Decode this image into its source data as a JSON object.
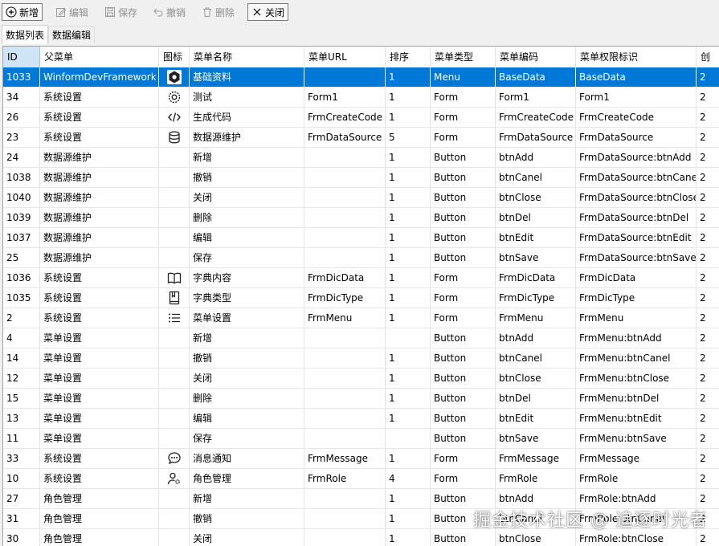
{
  "toolbar": {
    "new": "新增",
    "edit": "编辑",
    "save": "保存",
    "cancel": "撤销",
    "delete": "删除",
    "close": "关闭"
  },
  "tabs": [
    "数据列表",
    "数据编辑"
  ],
  "columns": [
    "ID",
    "父菜单",
    "图标",
    "菜单名称",
    "菜单URL",
    "排序",
    "菜单类型",
    "菜单编码",
    "菜单权限标识",
    "创"
  ],
  "colors": {
    "selection": "#0078d7",
    "header_id_bg": "#cfe4f7"
  },
  "rows": [
    {
      "id": "1033",
      "parent": "WinformDevFramework",
      "icon": "hexagon-icon",
      "name": "基础资料",
      "url": "",
      "sort": "1",
      "type": "Menu",
      "code": "BaseData",
      "perm": "BaseData",
      "extra": "2"
    },
    {
      "id": "34",
      "parent": "系统设置",
      "icon": "settings-icon",
      "name": "测试",
      "url": "Form1",
      "sort": "1",
      "type": "Form",
      "code": "Form1",
      "perm": "Form1",
      "extra": "2"
    },
    {
      "id": "26",
      "parent": "系统设置",
      "icon": "code-icon",
      "name": "生成代码",
      "url": "FrmCreateCode",
      "sort": "1",
      "type": "Form",
      "code": "FrmCreateCode",
      "perm": "FrmCreateCode",
      "extra": "2"
    },
    {
      "id": "23",
      "parent": "系统设置",
      "icon": "database-icon",
      "name": "数据源维护",
      "url": "FrmDataSource",
      "sort": "5",
      "type": "Form",
      "code": "FrmDataSource",
      "perm": "FrmDataSource",
      "extra": "2"
    },
    {
      "id": "24",
      "parent": "数据源维护",
      "icon": "",
      "name": "新增",
      "url": "",
      "sort": "1",
      "type": "Button",
      "code": "btnAdd",
      "perm": "FrmDataSource:btnAdd",
      "extra": "2"
    },
    {
      "id": "1038",
      "parent": "数据源维护",
      "icon": "",
      "name": "撤销",
      "url": "",
      "sort": "1",
      "type": "Button",
      "code": "btnCanel",
      "perm": "FrmDataSource:btnCanel",
      "extra": "2"
    },
    {
      "id": "1040",
      "parent": "数据源维护",
      "icon": "",
      "name": "关闭",
      "url": "",
      "sort": "1",
      "type": "Button",
      "code": "btnClose",
      "perm": "FrmDataSource:btnClose",
      "extra": "2"
    },
    {
      "id": "1039",
      "parent": "数据源维护",
      "icon": "",
      "name": "删除",
      "url": "",
      "sort": "1",
      "type": "Button",
      "code": "btnDel",
      "perm": "FrmDataSource:btnDel",
      "extra": "2"
    },
    {
      "id": "1037",
      "parent": "数据源维护",
      "icon": "",
      "name": "编辑",
      "url": "",
      "sort": "1",
      "type": "Button",
      "code": "btnEdit",
      "perm": "FrmDataSource:btnEdit",
      "extra": "2"
    },
    {
      "id": "25",
      "parent": "数据源维护",
      "icon": "",
      "name": "保存",
      "url": "",
      "sort": "1",
      "type": "Button",
      "code": "btnSave",
      "perm": "FrmDataSource:btnSave",
      "extra": "2"
    },
    {
      "id": "1036",
      "parent": "系统设置",
      "icon": "book-open-icon",
      "name": "字典内容",
      "url": "FrmDicData",
      "sort": "1",
      "type": "Form",
      "code": "FrmDicData",
      "perm": "FrmDicData",
      "extra": "2"
    },
    {
      "id": "1035",
      "parent": "系统设置",
      "icon": "book-icon",
      "name": "字典类型",
      "url": "FrmDicType",
      "sort": "1",
      "type": "Form",
      "code": "FrmDicType",
      "perm": "FrmDicType",
      "extra": "2"
    },
    {
      "id": "2",
      "parent": "系统设置",
      "icon": "list-icon",
      "name": "菜单设置",
      "url": "FrmMenu",
      "sort": "1",
      "type": "Form",
      "code": "FrmMenu",
      "perm": "FrmMenu",
      "extra": "2"
    },
    {
      "id": "4",
      "parent": "菜单设置",
      "icon": "",
      "name": "新增",
      "url": "",
      "sort": "",
      "type": "Button",
      "code": "btnAdd",
      "perm": "FrmMenu:btnAdd",
      "extra": "2"
    },
    {
      "id": "14",
      "parent": "菜单设置",
      "icon": "",
      "name": "撤销",
      "url": "",
      "sort": "1",
      "type": "Button",
      "code": "btnCanel",
      "perm": "FrmMenu:btnCanel",
      "extra": "2"
    },
    {
      "id": "12",
      "parent": "菜单设置",
      "icon": "",
      "name": "关闭",
      "url": "",
      "sort": "1",
      "type": "Button",
      "code": "btnClose",
      "perm": "FrmMenu:btnClose",
      "extra": "2"
    },
    {
      "id": "15",
      "parent": "菜单设置",
      "icon": "",
      "name": "删除",
      "url": "",
      "sort": "1",
      "type": "Button",
      "code": "btnDel",
      "perm": "FrmMenu:btnDel",
      "extra": "2"
    },
    {
      "id": "13",
      "parent": "菜单设置",
      "icon": "",
      "name": "编辑",
      "url": "",
      "sort": "1",
      "type": "Button",
      "code": "btnEdit",
      "perm": "FrmMenu:btnEdit",
      "extra": "2"
    },
    {
      "id": "11",
      "parent": "菜单设置",
      "icon": "",
      "name": "保存",
      "url": "",
      "sort": "",
      "type": "Button",
      "code": "btnSave",
      "perm": "FrmMenu:btnSave",
      "extra": "2"
    },
    {
      "id": "33",
      "parent": "系统设置",
      "icon": "message-icon",
      "name": "消息通知",
      "url": "FrmMessage",
      "sort": "1",
      "type": "Form",
      "code": "FrmMessage",
      "perm": "FrmMessage",
      "extra": "2"
    },
    {
      "id": "10",
      "parent": "系统设置",
      "icon": "user-settings-icon",
      "name": "角色管理",
      "url": "FrmRole",
      "sort": "4",
      "type": "Form",
      "code": "FrmRole",
      "perm": "FrmRole",
      "extra": "2"
    },
    {
      "id": "27",
      "parent": "角色管理",
      "icon": "",
      "name": "新增",
      "url": "",
      "sort": "1",
      "type": "Button",
      "code": "btnAdd",
      "perm": "FrmRole:btnAdd",
      "extra": "2"
    },
    {
      "id": "31",
      "parent": "角色管理",
      "icon": "",
      "name": "撤销",
      "url": "",
      "sort": "1",
      "type": "Button",
      "code": "btnCanel",
      "perm": "FrmRole:btnCanel",
      "extra": "2"
    },
    {
      "id": "30",
      "parent": "角色管理",
      "icon": "",
      "name": "关闭",
      "url": "",
      "sort": "1",
      "type": "Button",
      "code": "btnClose",
      "perm": "FrmRole:btnClose",
      "extra": "2"
    }
  ],
  "watermark": "掘金技术社区 @ 追逐时光者"
}
